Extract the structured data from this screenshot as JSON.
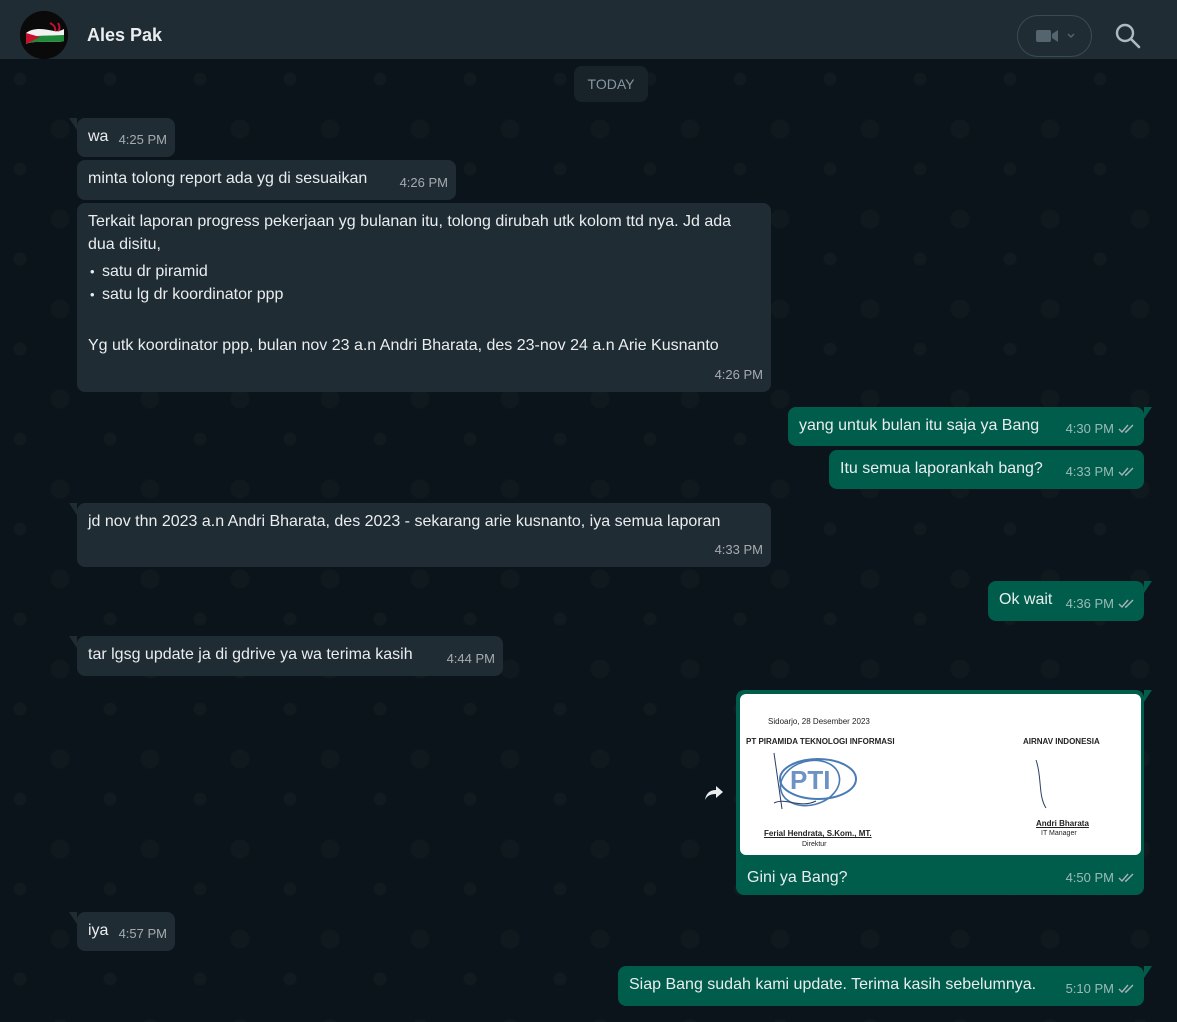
{
  "header": {
    "contact_name": "Ales Pak"
  },
  "icons": {
    "video": "video-camera-icon",
    "chevron": "chevron-down-icon",
    "search": "search-icon",
    "forward": "forward-icon",
    "ticks": "double-check-icon"
  },
  "colors": {
    "incoming_bubble": "#202c33",
    "outgoing_bubble": "#005c4b",
    "header": "#202c33",
    "background": "#0b141a",
    "read_ticks": "#a8b3b8"
  },
  "chat": {
    "day_label": "TODAY",
    "messages": [
      {
        "dir": "in",
        "text": "wa",
        "time": "4:25 PM"
      },
      {
        "dir": "in",
        "text": "minta tolong report ada yg di sesuaikan",
        "time": "4:26 PM"
      },
      {
        "dir": "in",
        "intro": "Terkait laporan progress pekerjaan yg bulanan itu, tolong dirubah utk kolom ttd nya. Jd ada dua disitu,",
        "bullets": [
          "satu dr piramid",
          "satu lg dr koordinator ppp"
        ],
        "outro": "Yg utk koordinator ppp, bulan nov 23 a.n Andri Bharata, des 23-nov 24 a.n Arie Kusnanto",
        "time": "4:26 PM"
      },
      {
        "dir": "out",
        "text": "yang untuk bulan itu saja ya Bang",
        "time": "4:30 PM"
      },
      {
        "dir": "out",
        "text": "Itu semua laporankah bang?",
        "time": "4:33 PM"
      },
      {
        "dir": "in",
        "text": "jd nov thn 2023 a.n Andri Bharata, des 2023 - sekarang arie kusnanto, iya semua laporan",
        "time": "4:33 PM"
      },
      {
        "dir": "out",
        "text": "Ok wait",
        "time": "4:36 PM"
      },
      {
        "dir": "in",
        "text": "tar lgsg update ja di gdrive ya wa terima kasih",
        "time": "4:44 PM"
      },
      {
        "dir": "out",
        "text": "Gini ya Bang?",
        "time": "4:50 PM",
        "attachment": {
          "date_line": "Sidoarjo, 28 Desember 2023",
          "left_org": "PT PIRAMIDA TEKNOLOGI INFORMASI",
          "right_org": "AIRNAV INDONESIA",
          "logo_text": "PTI",
          "left_signer": "Ferial Hendrata, S.Kom., MT.",
          "left_role": "Direktur",
          "right_signer": "Andri Bharata",
          "right_role": "IT Manager"
        }
      },
      {
        "dir": "in",
        "text": "iya",
        "time": "4:57 PM"
      },
      {
        "dir": "out",
        "text": "Siap Bang sudah kami update. Terima kasih sebelumnya.",
        "time": "5:10 PM"
      }
    ]
  }
}
